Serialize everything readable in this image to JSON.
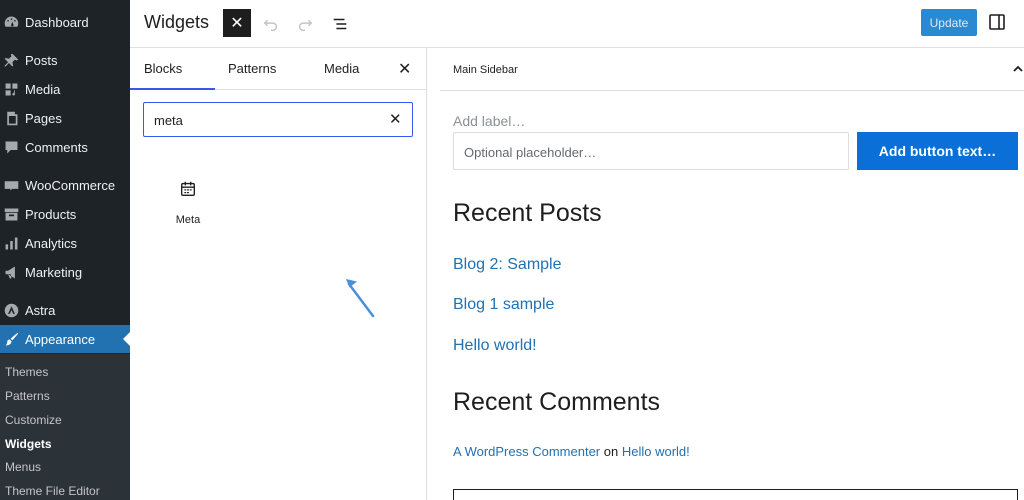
{
  "admin_menu": {
    "items": [
      {
        "label": "Dashboard",
        "icon": "dashboard-icon"
      },
      {
        "label": "Posts",
        "icon": "pin-icon"
      },
      {
        "label": "Media",
        "icon": "media-icon"
      },
      {
        "label": "Pages",
        "icon": "pages-icon"
      },
      {
        "label": "Comments",
        "icon": "comment-icon"
      },
      {
        "label": "WooCommerce",
        "icon": "woocommerce-icon"
      },
      {
        "label": "Products",
        "icon": "archive-icon"
      },
      {
        "label": "Analytics",
        "icon": "bar-chart-icon"
      },
      {
        "label": "Marketing",
        "icon": "megaphone-icon"
      },
      {
        "label": "Astra",
        "icon": "astra-icon"
      },
      {
        "label": "Appearance",
        "icon": "paintbrush-icon",
        "active": true
      }
    ],
    "submenu": [
      "Themes",
      "Patterns",
      "Customize",
      "Widgets",
      "Menus",
      "Theme File Editor"
    ],
    "current_submenu": "Widgets"
  },
  "toolbar": {
    "title": "Widgets",
    "close_glyph": "✕",
    "update_label": "Update"
  },
  "inserter": {
    "tabs": [
      "Blocks",
      "Patterns",
      "Media"
    ],
    "active_tab": "Blocks",
    "close_glyph": "✕",
    "search_value": "meta",
    "clear_glyph": "✕",
    "result": {
      "label": "Meta",
      "icon": "calendar-icon"
    }
  },
  "widget_area": {
    "title": "Main Sidebar",
    "search_label": "Add label…",
    "search_placeholder": "Optional placeholder…",
    "search_button": "Add button text…",
    "recent_posts_heading": "Recent Posts",
    "posts": [
      "Blog 2: Sample",
      "Blog 1 sample",
      "Hello world!"
    ],
    "recent_comments_heading": "Recent Comments",
    "comment": {
      "author": "A WordPress Commenter",
      "connector": "on",
      "post": "Hello world!"
    }
  },
  "colors": {
    "admin_bg": "#1d2327",
    "active_blue": "#2271b1",
    "button_blue": "#0a6fd6",
    "focus_blue": "#3858e9"
  }
}
